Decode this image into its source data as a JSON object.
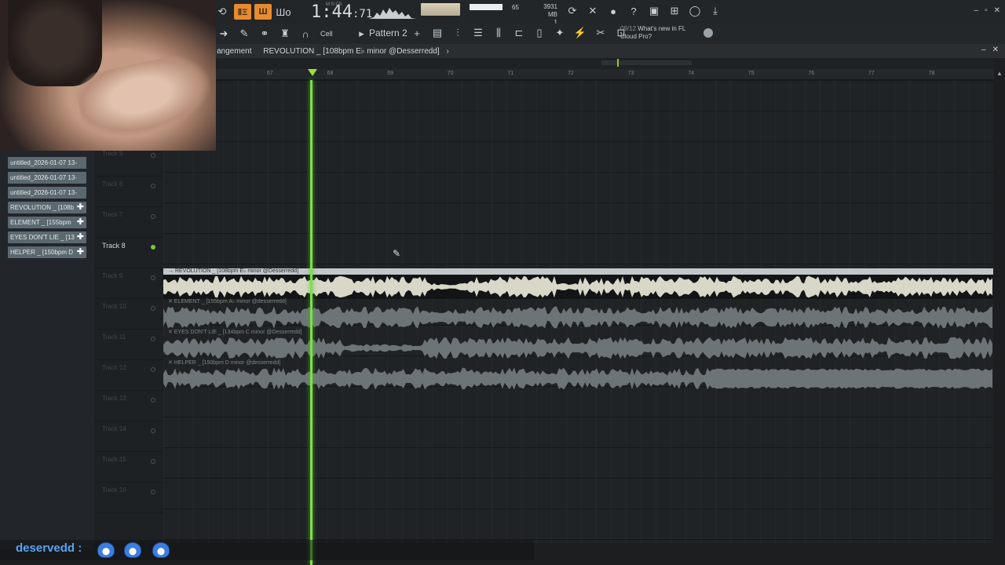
{
  "toolbar": {
    "time": "1:44",
    "time_frac": ":71",
    "time_unit": "M:S:CS",
    "cpu": "65",
    "memory": "3931 MB",
    "memory_sub": "1",
    "pattern": "Pattern 2",
    "snap": "Cell",
    "news_date": "09/12",
    "news_text_1": "What's new in FL",
    "news_text_2": "Cloud Pro?",
    "mode_buttons": [
      "ⅡΞ",
      "Ш"
    ]
  },
  "window": {
    "breadcrumb_left": "angement",
    "breadcrumb_item": "REVOLUTION _ [108bpm E♭ minor @Desserredd]",
    "breadcrumb_arrow": "›"
  },
  "ruler": {
    "ticks": [
      "67",
      "68",
      "69",
      "70",
      "71",
      "72",
      "73",
      "74",
      "75",
      "76",
      "77",
      "78"
    ]
  },
  "sidebar": {
    "items": [
      {
        "label": "untitled_2026-01-07 13-",
        "has_plus": false
      },
      {
        "label": "untitled_2026-01-07 13-",
        "has_plus": false
      },
      {
        "label": "untitled_2026-01-07 13-",
        "has_plus": false
      },
      {
        "label": "REVOLUTION _ [108b",
        "has_plus": true
      },
      {
        "label": "ELEMENT _ [155bpm",
        "has_plus": true
      },
      {
        "label": "EYES DON'T LIE _ [13",
        "has_plus": true
      },
      {
        "label": "HELPER _ [150bpm D",
        "has_plus": true
      }
    ]
  },
  "tracks": [
    {
      "label": "",
      "active": false
    },
    {
      "label": "Track 5",
      "active": false
    },
    {
      "label": "Track 6",
      "active": false
    },
    {
      "label": "Track 7",
      "active": false
    },
    {
      "label": "Track 8",
      "active": true
    },
    {
      "label": "Track 9",
      "active": false
    },
    {
      "label": "Track 10",
      "active": false
    },
    {
      "label": "Track 11",
      "active": false
    },
    {
      "label": "Track 12",
      "active": false
    },
    {
      "label": "Track 13",
      "active": false
    },
    {
      "label": "Track 14",
      "active": false
    },
    {
      "label": "Track 15",
      "active": false
    },
    {
      "label": "Track 16",
      "active": false
    }
  ],
  "clips": [
    {
      "title": "→ REVOLUTION _ [108bpm E♭ minor @Desserredd]",
      "style": "bright"
    },
    {
      "title": "✕ ELEMENT _ [155bpm A♭ minor @desserredd]",
      "style": "dim"
    },
    {
      "title": "✕ EYES DON'T LIE _ [134bpm C minor @Desserredd]",
      "style": "dim"
    },
    {
      "title": "✕ HELPER _ [150bpm D minor @desserredd]",
      "style": "dim"
    }
  ],
  "chat": {
    "user": "deservedd",
    "separator": ":"
  },
  "colors": {
    "playhead": "#7ee04a",
    "accent": "#e88a2e",
    "chat_user": "#5aa3f0"
  }
}
